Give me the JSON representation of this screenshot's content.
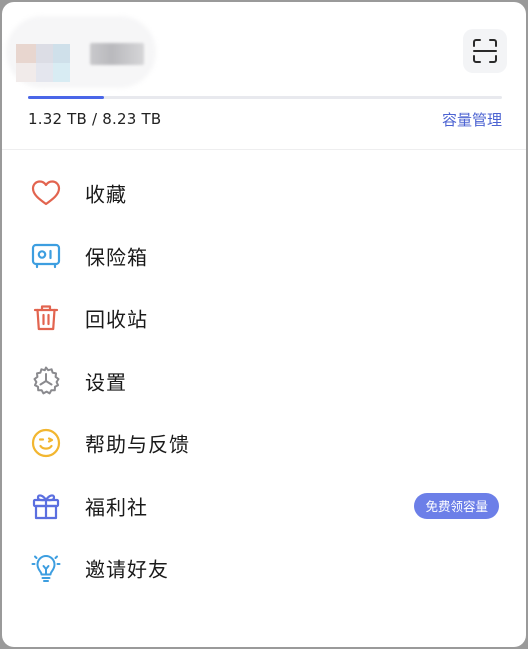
{
  "header": {
    "avatar_name": "avatar",
    "username_name": "username",
    "scan_icon": "scan-icon"
  },
  "storage": {
    "used": "1.32 TB",
    "separator": "/",
    "total": "8.23 TB",
    "fraction": 0.16,
    "manage_label": "容量管理"
  },
  "menu": {
    "items": [
      {
        "label": "收藏",
        "icon": "heart-icon",
        "color": "#e2644f"
      },
      {
        "label": "保险箱",
        "icon": "safe-icon",
        "color": "#3d9ee0"
      },
      {
        "label": "回收站",
        "icon": "trash-icon",
        "color": "#e2644f"
      },
      {
        "label": "设置",
        "icon": "gear-icon",
        "color": "#8a8a8e"
      },
      {
        "label": "帮助与反馈",
        "icon": "smiley-icon",
        "color": "#f2b630"
      },
      {
        "label": "福利社",
        "icon": "gift-icon",
        "color": "#5b6fe0",
        "badge": "免费领容量"
      },
      {
        "label": "邀请好友",
        "icon": "lightbulb-icon",
        "color": "#3d9ee0"
      }
    ]
  },
  "colors": {
    "accent": "#4a66e8",
    "badge_bg": "#6c7fe8",
    "link": "#4c63d2"
  }
}
